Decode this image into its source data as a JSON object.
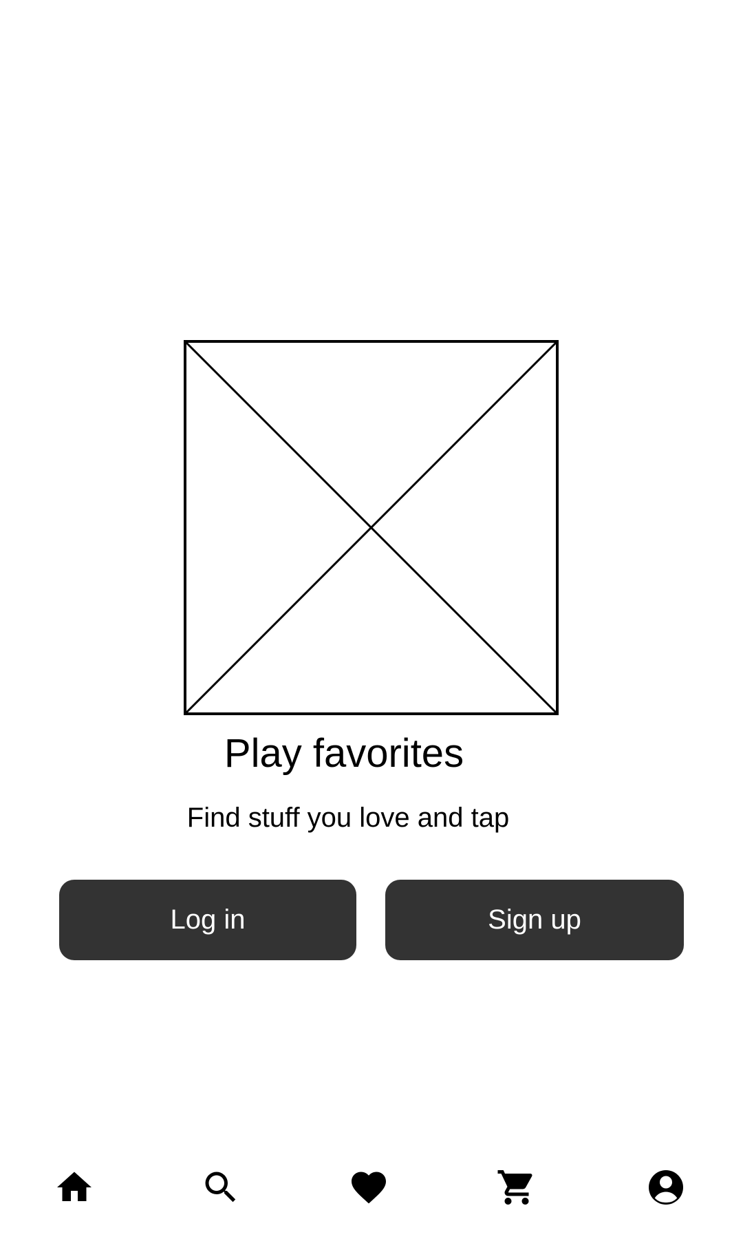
{
  "hero": {
    "headline": "Play favorites",
    "subline": "Find stuff you love and tap"
  },
  "actions": {
    "login_label": "Log in",
    "signup_label": "Sign up"
  },
  "bottom_nav": {
    "items": [
      {
        "icon": "home-icon"
      },
      {
        "icon": "search-icon"
      },
      {
        "icon": "heart-icon"
      },
      {
        "icon": "cart-icon"
      },
      {
        "icon": "account-icon"
      }
    ]
  },
  "colors": {
    "button_bg": "#333333",
    "button_text": "#ffffff",
    "text": "#000000",
    "background": "#ffffff"
  }
}
